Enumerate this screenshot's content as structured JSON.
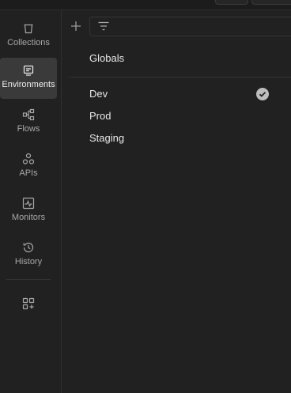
{
  "sidebar": {
    "items": [
      {
        "label": "Collections",
        "icon": "trash-can-icon",
        "active": false
      },
      {
        "label": "Environments",
        "icon": "environment-icon",
        "active": true
      },
      {
        "label": "Flows",
        "icon": "flows-icon",
        "active": false
      },
      {
        "label": "APIs",
        "icon": "apis-icon",
        "active": false
      },
      {
        "label": "Monitors",
        "icon": "monitor-icon",
        "active": false
      },
      {
        "label": "History",
        "icon": "history-icon",
        "active": false
      }
    ],
    "extra_icon": "add-workbench-icon"
  },
  "main": {
    "add_icon": "plus-icon",
    "filter": {
      "icon": "filter-icon",
      "placeholder": "",
      "value": ""
    },
    "globals_label": "Globals",
    "environments": [
      {
        "label": "Dev",
        "selected": true
      },
      {
        "label": "Prod",
        "selected": false
      },
      {
        "label": "Staging",
        "selected": false
      }
    ]
  },
  "colors": {
    "background": "#212121",
    "active_nav": "#3a3a3a",
    "check": "#bdbdbd"
  }
}
